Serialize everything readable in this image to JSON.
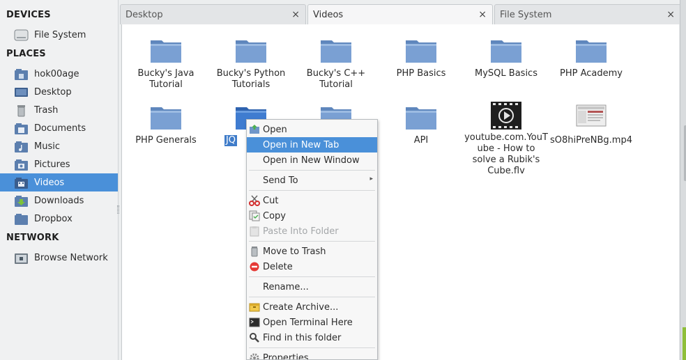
{
  "sidebar": {
    "sections": {
      "devices": "DEVICES",
      "places": "PLACES",
      "network": "NETWORK"
    },
    "devices": [
      {
        "label": "File System",
        "icon": "drive-icon"
      }
    ],
    "places": [
      {
        "label": "hok00age",
        "icon": "home-icon"
      },
      {
        "label": "Desktop",
        "icon": "desktop-icon"
      },
      {
        "label": "Trash",
        "icon": "trash-icon"
      },
      {
        "label": "Documents",
        "icon": "documents-folder-icon"
      },
      {
        "label": "Music",
        "icon": "music-folder-icon"
      },
      {
        "label": "Pictures",
        "icon": "pictures-folder-icon"
      },
      {
        "label": "Videos",
        "icon": "videos-folder-icon",
        "active": true
      },
      {
        "label": "Downloads",
        "icon": "downloads-folder-icon"
      },
      {
        "label": "Dropbox",
        "icon": "dropbox-folder-icon"
      }
    ],
    "network": [
      {
        "label": "Browse Network",
        "icon": "network-icon"
      }
    ]
  },
  "tabs": [
    {
      "label": "Desktop",
      "close": "×"
    },
    {
      "label": "Videos",
      "close": "×",
      "active": true
    },
    {
      "label": "File System",
      "close": "×"
    }
  ],
  "files": [
    {
      "name": "Bucky's Java\nTutorial",
      "type": "folder"
    },
    {
      "name": "Bucky's Python\nTutorials",
      "type": "folder"
    },
    {
      "name": "Bucky's C++\nTutorial",
      "type": "folder"
    },
    {
      "name": "PHP Basics",
      "type": "folder"
    },
    {
      "name": "MySQL Basics",
      "type": "folder"
    },
    {
      "name": "PHP Academy",
      "type": "folder"
    },
    {
      "name": "PHP Generals",
      "type": "folder"
    },
    {
      "name": "JQ",
      "type": "folder",
      "selected": true
    },
    {
      "name": "",
      "type": "folder"
    },
    {
      "name": "API",
      "type": "folder"
    },
    {
      "name": "youtube.com.YouT\nube - How to\nsolve a Rubik's\nCube.flv",
      "type": "video"
    },
    {
      "name": "sO8hiPreNBg.mp4",
      "type": "video-thumb"
    }
  ],
  "context_menu": {
    "items": [
      {
        "label": "Open",
        "icon": "open-icon"
      },
      {
        "label": "Open in New Tab",
        "highlighted": true
      },
      {
        "label": "Open in New Window"
      },
      {
        "label": "Send To",
        "submenu_arrow": "▸"
      },
      {
        "label": "Cut",
        "icon": "scissors-icon"
      },
      {
        "label": "Copy",
        "icon": "copy-icon"
      },
      {
        "label": "Paste Into Folder",
        "icon": "paste-icon",
        "disabled": true
      },
      {
        "label": "Move to Trash",
        "icon": "trash-icon"
      },
      {
        "label": "Delete",
        "icon": "delete-icon"
      },
      {
        "label": "Rename..."
      },
      {
        "label": "Create Archive...",
        "icon": "archive-icon"
      },
      {
        "label": "Open Terminal Here",
        "icon": "terminal-icon"
      },
      {
        "label": "Find in this folder",
        "icon": "search-icon"
      },
      {
        "label": "Properties...",
        "icon": "properties-icon"
      }
    ]
  },
  "colors": {
    "selection": "#4a90d9",
    "folder": "#6f9ad0"
  }
}
